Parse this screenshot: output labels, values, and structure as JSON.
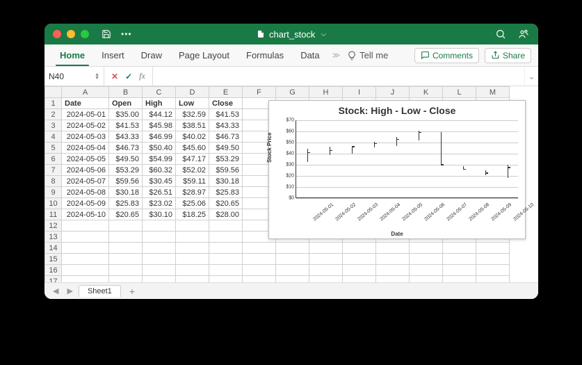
{
  "titlebar": {
    "filename": "chart_stock"
  },
  "ribbon": {
    "tabs": [
      "Home",
      "Insert",
      "Draw",
      "Page Layout",
      "Formulas",
      "Data"
    ],
    "active": "Home",
    "tellme": "Tell me",
    "comments": "Comments",
    "share": "Share"
  },
  "formula": {
    "namebox": "N40",
    "value": ""
  },
  "columns": [
    "A",
    "B",
    "C",
    "D",
    "E",
    "F",
    "G",
    "H",
    "I",
    "J",
    "K",
    "L",
    "M"
  ],
  "headers": {
    "A": "Date",
    "B": "Open",
    "C": "High",
    "D": "Low",
    "E": "Close"
  },
  "rows": [
    {
      "date": "2024-05-01",
      "open": "$35.00",
      "high": "$44.12",
      "low": "$32.59",
      "close": "$41.53"
    },
    {
      "date": "2024-05-02",
      "open": "$41.53",
      "high": "$45.98",
      "low": "$38.51",
      "close": "$43.33"
    },
    {
      "date": "2024-05-03",
      "open": "$43.33",
      "high": "$46.99",
      "low": "$40.02",
      "close": "$46.73"
    },
    {
      "date": "2024-05-04",
      "open": "$46.73",
      "high": "$50.40",
      "low": "$45.60",
      "close": "$49.50"
    },
    {
      "date": "2024-05-05",
      "open": "$49.50",
      "high": "$54.99",
      "low": "$47.17",
      "close": "$53.29"
    },
    {
      "date": "2024-05-06",
      "open": "$53.29",
      "high": "$60.32",
      "low": "$52.02",
      "close": "$59.56"
    },
    {
      "date": "2024-05-07",
      "open": "$59.56",
      "high": "$30.45",
      "low": "$59.11",
      "close": "$30.18"
    },
    {
      "date": "2024-05-08",
      "open": "$30.18",
      "high": "$26.51",
      "low": "$28.97",
      "close": "$25.83"
    },
    {
      "date": "2024-05-09",
      "open": "$25.83",
      "high": "$23.02",
      "low": "$25.06",
      "close": "$20.65"
    },
    {
      "date": "2024-05-10",
      "open": "$20.65",
      "high": "$30.10",
      "low": "$18.25",
      "close": "$28.00"
    }
  ],
  "blank_rows": [
    12,
    13,
    14,
    15,
    16,
    17
  ],
  "sheets": {
    "active": "Sheet1"
  },
  "chart_data": {
    "type": "stock-hlc",
    "title": "Stock: High - Low - Close",
    "xlabel": "Date",
    "ylabel": "Stock Price",
    "ylim": [
      0,
      70
    ],
    "yticks": [
      0,
      10,
      20,
      30,
      40,
      50,
      60,
      70
    ],
    "categories": [
      "2024-05-01",
      "2024-05-02",
      "2024-05-03",
      "2024-05-04",
      "2024-05-05",
      "2024-05-06",
      "2024-05-07",
      "2024-05-08",
      "2024-05-09",
      "2024-05-10"
    ],
    "series": {
      "high": [
        44.12,
        45.98,
        46.99,
        50.4,
        54.99,
        60.32,
        59.11,
        28.97,
        25.06,
        30.1
      ],
      "low": [
        32.59,
        38.51,
        40.02,
        45.6,
        47.17,
        52.02,
        30.18,
        25.83,
        20.65,
        18.25
      ],
      "close": [
        41.53,
        43.33,
        46.73,
        49.5,
        53.29,
        59.56,
        30.45,
        26.51,
        23.02,
        28.0
      ]
    }
  }
}
